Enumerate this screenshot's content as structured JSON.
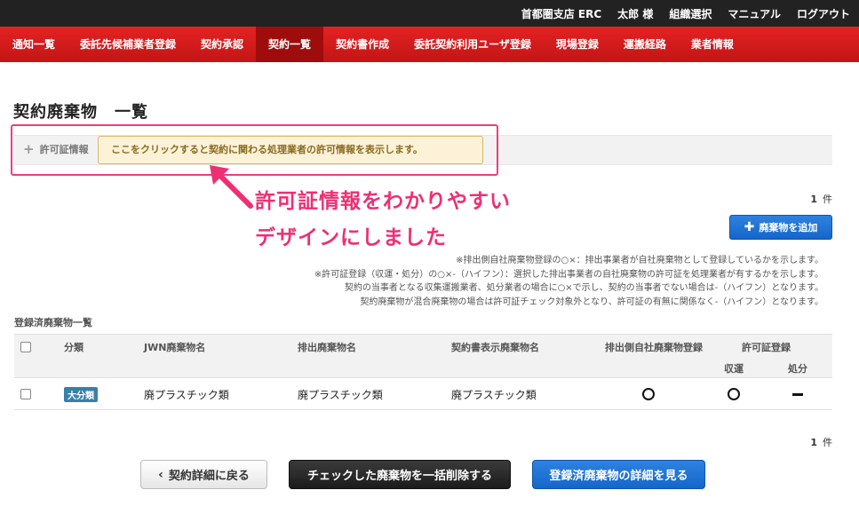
{
  "topbar": {
    "org": "首都圏支店 ERC",
    "user": "太郎 様",
    "org_select": "組織選択",
    "manual": "マニュアル",
    "logout": "ログアウト"
  },
  "nav": {
    "items": [
      "通知一覧",
      "委託先候補業者登録",
      "契約承認",
      "契約一覧",
      "契約書作成",
      "委託契約利用ユーザ登録",
      "現場登録",
      "運搬経路",
      "業者情報"
    ],
    "active_index": 3
  },
  "page": {
    "title": "契約廃棄物　一覧"
  },
  "permit": {
    "toggle_label": "許可証情報",
    "tooltip": "ここをクリックすると契約に関わる処理業者の許可情報を表示します。",
    "annotation_line1": "許可証情報をわかりやすい",
    "annotation_line2": "デザインにしました"
  },
  "count": {
    "value": "1",
    "unit": "件"
  },
  "add_button": {
    "label": "廃棄物を追加",
    "icon": "plus-icon"
  },
  "notes": [
    "※排出側自社廃棄物登録の○×：排出事業者が自社廃棄物として登録しているかを示します。",
    "※許可証登録（収運・処分）の○×-（ハイフン）：選択した排出事業者の自社廃棄物の許可証を処理業者が有するかを示します。",
    "契約の当事者となる収集運搬業者、処分業者の場合に○×で示し、契約の当事者でない場合は-（ハイフン）となります。",
    "契約廃棄物が混合廃棄物の場合は許可証チェック対象外となり、許可証の有無に関係なく-（ハイフン）となります。"
  ],
  "list_title": "登録済廃棄物一覧",
  "table": {
    "headers": {
      "category": "分類",
      "jwn": "JWN廃棄物名",
      "discharge": "排出廃棄物名",
      "contract": "契約書表示廃棄物名",
      "own": "排出側自社廃棄物登録",
      "permit": "許可証登録",
      "transport": "収運",
      "disposal": "処分"
    },
    "rows": [
      {
        "badge": "大分類",
        "jwn": "廃プラスチック類",
        "discharge": "廃プラスチック類",
        "contract": "廃プラスチック類",
        "own": "○",
        "transport": "○",
        "disposal": "－"
      }
    ]
  },
  "buttons": {
    "back": "契約詳細に戻る",
    "delete": "チェックした廃棄物を一括削除する",
    "detail": "登録済廃棄物の詳細を見る"
  },
  "colors": {
    "nav_red": "#d41b1b",
    "nav_active": "#9f0c0c",
    "topbar": "#222222",
    "primary_blue": "#1a6fd6",
    "annotation_pink": "#ee2f73",
    "tooltip_bg": "#fcf2d8",
    "badge_blue": "#3a7fa7"
  }
}
